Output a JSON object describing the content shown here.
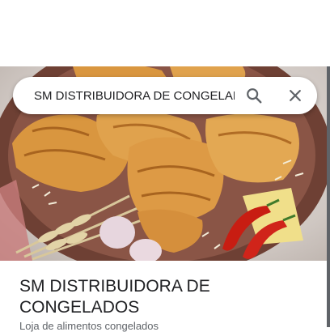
{
  "search": {
    "query": "SM DISTRIBUIDORA DE CONGELADOS",
    "search_icon": "search-icon",
    "close_icon": "close-icon"
  },
  "place": {
    "name": "SM DISTRIBUIDORA DE CONGELADOS",
    "category": "Loja de alimentos congelados"
  },
  "photo": {
    "subject": "croissants-photo"
  },
  "colors": {
    "text_primary": "#202124",
    "text_secondary": "#5f6368",
    "plate": "#7a4a3d",
    "croissant": "#d9963f"
  }
}
